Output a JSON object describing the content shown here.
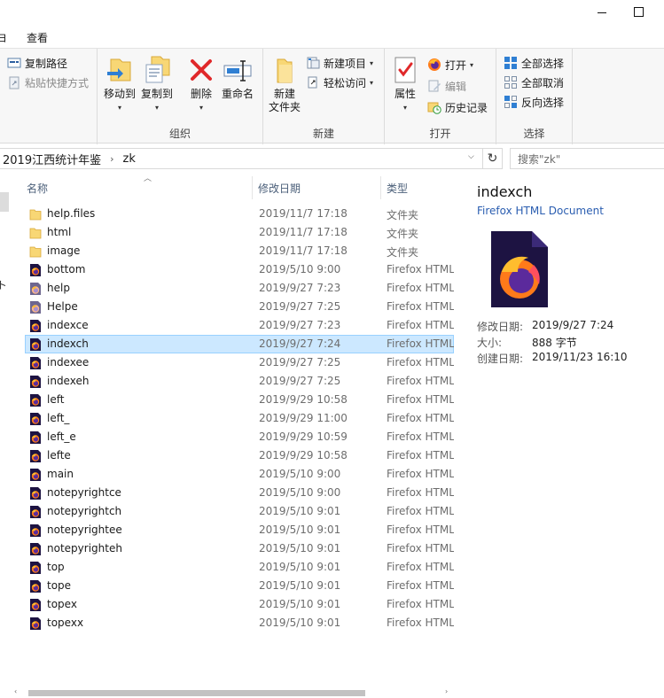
{
  "window": {
    "minimize_label": "",
    "maximize_label": ""
  },
  "tabs": {
    "view": "查看"
  },
  "ribbon": {
    "clipboard": {
      "copy_path": "复制路径",
      "paste_shortcut": "粘贴快捷方式"
    },
    "organize": {
      "label": "组织",
      "move_to": "移动到",
      "copy_to": "复制到",
      "delete": "删除",
      "rename": "重命名"
    },
    "new": {
      "label": "新建",
      "new_folder_line1": "新建",
      "new_folder_line2": "文件夹",
      "new_item": "新建项目",
      "easy_access": "轻松访问"
    },
    "open": {
      "label": "打开",
      "properties": "属性",
      "open": "打开",
      "edit": "编辑",
      "history": "历史记录"
    },
    "select": {
      "label": "选择",
      "select_all": "全部选择",
      "select_none": "全部取消",
      "invert": "反向选择"
    }
  },
  "address": {
    "crumbs": [
      "2019江西统计年鉴",
      "zk"
    ],
    "search_placeholder": "搜索\"zk\""
  },
  "columns": {
    "name": "名称",
    "date": "修改日期",
    "type": "类型"
  },
  "files": [
    {
      "name": "help.files",
      "date": "2019/11/7 17:18",
      "type": "文件夹",
      "kind": "folder"
    },
    {
      "name": "html",
      "date": "2019/11/7 17:18",
      "type": "文件夹",
      "kind": "folder"
    },
    {
      "name": "image",
      "date": "2019/11/7 17:18",
      "type": "文件夹",
      "kind": "folder"
    },
    {
      "name": "bottom",
      "date": "2019/5/10 9:00",
      "type": "Firefox HTML",
      "kind": "firefox"
    },
    {
      "name": "help",
      "date": "2019/9/27 7:23",
      "type": "Firefox HTML",
      "kind": "firefox-pale"
    },
    {
      "name": "Helpe",
      "date": "2019/9/27 7:25",
      "type": "Firefox HTML",
      "kind": "firefox-pale"
    },
    {
      "name": "indexce",
      "date": "2019/9/27 7:23",
      "type": "Firefox HTML",
      "kind": "firefox"
    },
    {
      "name": "indexch",
      "date": "2019/9/27 7:24",
      "type": "Firefox HTML",
      "kind": "firefox",
      "selected": true
    },
    {
      "name": "indexee",
      "date": "2019/9/27 7:25",
      "type": "Firefox HTML",
      "kind": "firefox"
    },
    {
      "name": "indexeh",
      "date": "2019/9/27 7:25",
      "type": "Firefox HTML",
      "kind": "firefox"
    },
    {
      "name": "left",
      "date": "2019/9/29 10:58",
      "type": "Firefox HTML",
      "kind": "firefox"
    },
    {
      "name": "left_",
      "date": "2019/9/29 11:00",
      "type": "Firefox HTML",
      "kind": "firefox"
    },
    {
      "name": "left_e",
      "date": "2019/9/29 10:59",
      "type": "Firefox HTML",
      "kind": "firefox"
    },
    {
      "name": "lefte",
      "date": "2019/9/29 10:58",
      "type": "Firefox HTML",
      "kind": "firefox"
    },
    {
      "name": "main",
      "date": "2019/5/10 9:00",
      "type": "Firefox HTML",
      "kind": "firefox"
    },
    {
      "name": "notepyrightce",
      "date": "2019/5/10 9:00",
      "type": "Firefox HTML",
      "kind": "firefox"
    },
    {
      "name": "notepyrightch",
      "date": "2019/5/10 9:01",
      "type": "Firefox HTML",
      "kind": "firefox"
    },
    {
      "name": "notepyrightee",
      "date": "2019/5/10 9:01",
      "type": "Firefox HTML",
      "kind": "firefox"
    },
    {
      "name": "notepyrighteh",
      "date": "2019/5/10 9:01",
      "type": "Firefox HTML",
      "kind": "firefox"
    },
    {
      "name": "top",
      "date": "2019/5/10 9:01",
      "type": "Firefox HTML",
      "kind": "firefox"
    },
    {
      "name": "tope",
      "date": "2019/5/10 9:01",
      "type": "Firefox HTML",
      "kind": "firefox"
    },
    {
      "name": "topex",
      "date": "2019/5/10 9:01",
      "type": "Firefox HTML",
      "kind": "firefox"
    },
    {
      "name": "topexx",
      "date": "2019/5/10 9:01",
      "type": "Firefox HTML",
      "kind": "firefox"
    }
  ],
  "preview": {
    "title": "indexch",
    "subtitle": "Firefox HTML Document",
    "props": [
      {
        "key": "修改日期:",
        "value": "2019/9/27 7:24"
      },
      {
        "key": "大小:",
        "value": "888 字节"
      },
      {
        "key": "创建日期:",
        "value": "2019/11/23 16:10"
      }
    ]
  },
  "colors": {
    "selection_bg": "#cce8ff",
    "selection_border": "#99d1ff",
    "folder_yellow": "#f8d775",
    "link_blue": "#2a5db0"
  }
}
